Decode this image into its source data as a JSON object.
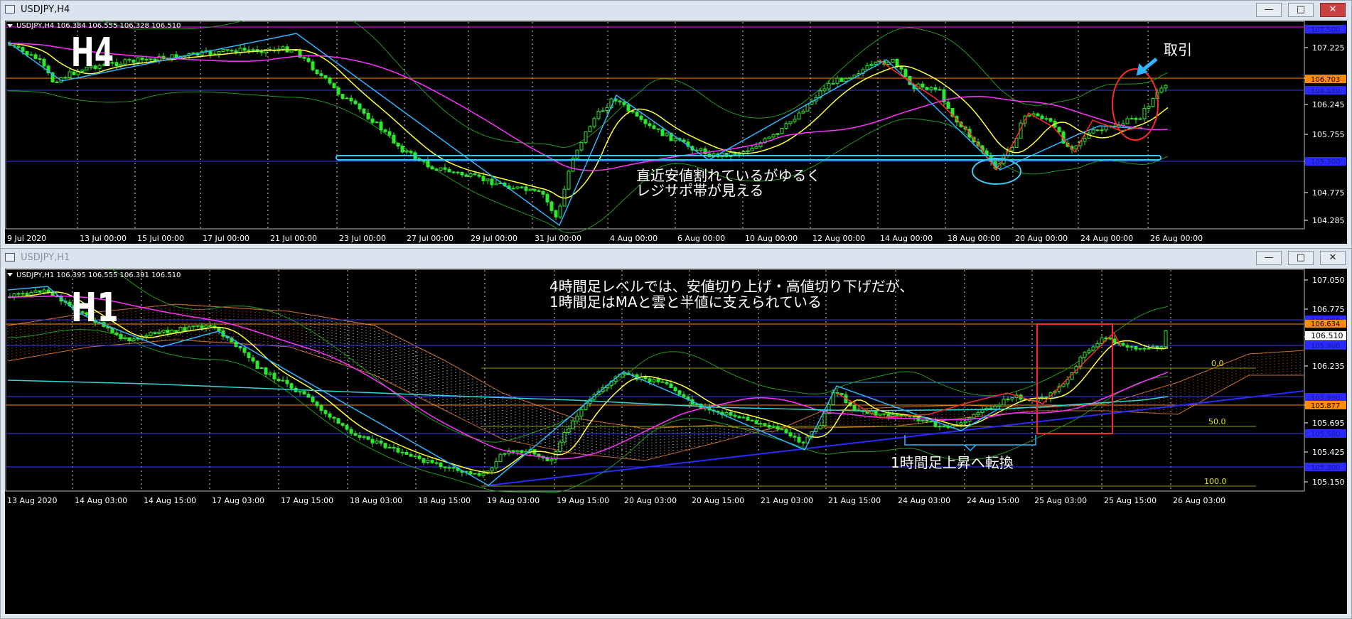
{
  "h4_window": {
    "title": "USDJPY,H4",
    "chart_label": "USDJPY,H4  106.384 106.555 106.328 106.510",
    "big_label": "H4",
    "buttons": {
      "minimize": "—",
      "maximize": "□",
      "close": "✕"
    },
    "annotation_trade": "取引",
    "annotation_zone_line1": "直近安値割れているがゆるく",
    "annotation_zone_line2": "レジサポ帯が見える",
    "price_axis": [
      "107.225",
      "106.703",
      "106.245",
      "105.755",
      "105.295",
      "104.775",
      "104.285"
    ],
    "time_axis": [
      "9 Jul 2020",
      "13 Jul 00:00",
      "15 Jul 00:00",
      "17 Jul 00:00",
      "21 Jul 00:00",
      "23 Jul 00:00",
      "27 Jul 00:00",
      "29 Jul 00:00",
      "31 Jul 00:00",
      "4 Aug 00:00",
      "6 Aug 00:00",
      "10 Aug 00:00",
      "12 Aug 00:00",
      "14 Aug 00:00",
      "18 Aug 00:00",
      "20 Aug 00:00",
      "24 Aug 00:00",
      "26 Aug 00:00"
    ],
    "hidden_price_tags": [
      "107.500",
      "106.550",
      "105.300"
    ],
    "orange_price_tag": "106.703"
  },
  "h1_window": {
    "title": "USDJPY,H1",
    "chart_label": "USDJPY,H1  106.395 106.555 106.391 106.510",
    "big_label": "H1",
    "buttons": {
      "minimize": "—",
      "maximize": "□",
      "close": "✕"
    },
    "annotation_top_line1": "4時間足レベルでは、安値切り上げ・高値切り下げだが、",
    "annotation_top_line2": "1時間足はMAと雲と半値に支えられている",
    "annotation_bottom": "1時間足上昇へ転換",
    "fib_labels": [
      "0.0",
      "50.0",
      "100.0"
    ],
    "price_axis": [
      "107.050",
      "106.775",
      "106.510",
      "106.235",
      "105.877",
      "105.695",
      "105.425",
      "105.150"
    ],
    "current_price": "106.510",
    "orange_price_tags": [
      "106.634",
      "105.877"
    ],
    "blue_price_tags": [
      "106.555",
      "105.990",
      "105.560",
      "105.300"
    ],
    "time_axis": [
      "13 Aug 2020",
      "14 Aug 03:00",
      "14 Aug 15:00",
      "17 Aug 03:00",
      "17 Aug 15:00",
      "18 Aug 03:00",
      "18 Aug 15:00",
      "19 Aug 03:00",
      "19 Aug 15:00",
      "20 Aug 03:00",
      "20 Aug 15:00",
      "21 Aug 03:00",
      "21 Aug 15:00",
      "24 Aug 03:00",
      "24 Aug 15:00",
      "25 Aug 03:00",
      "25 Aug 15:00",
      "26 Aug 03:00"
    ]
  },
  "colors": {
    "background": "#000000",
    "candle": "#2ee82e",
    "yellow_ma": "#ffff3a",
    "magenta_ma": "#ff30ff",
    "bollinger": "#1f9a1f",
    "zigzag": "#2fb4ff",
    "red_zigzag": "#ff2a2a",
    "zone": "#3ec8f0",
    "orange_line": "#ff8c00",
    "blue_line": "#2a2aff",
    "cyan_ma": "#33d6d6",
    "text": "#ffffff"
  }
}
